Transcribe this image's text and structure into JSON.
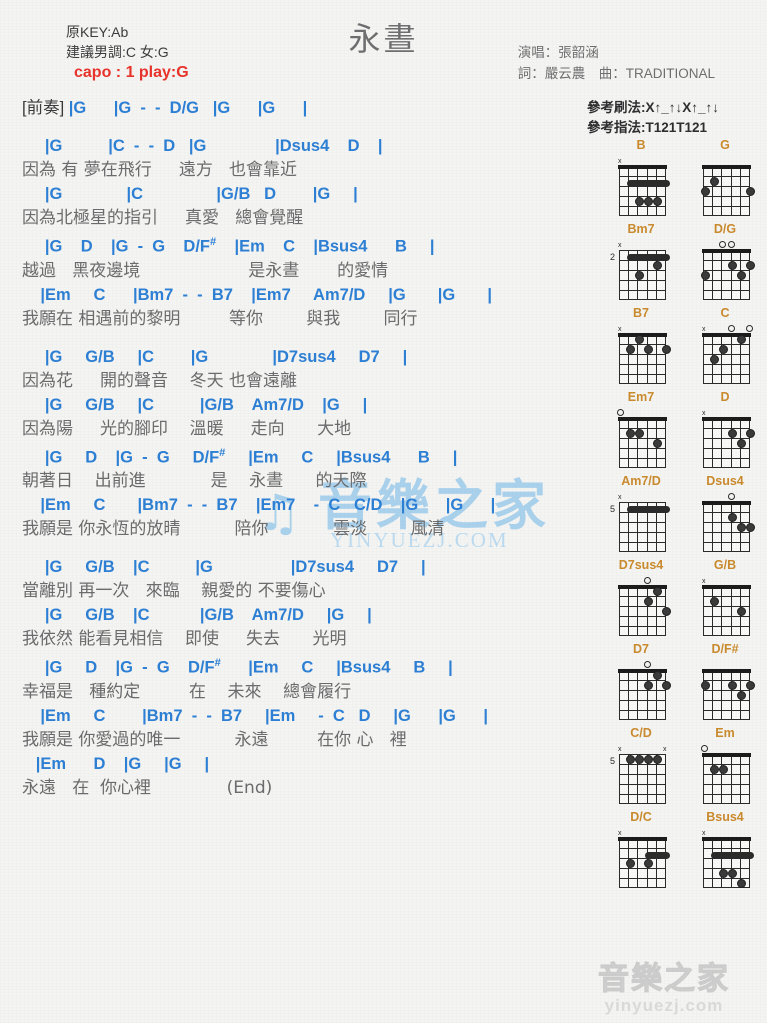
{
  "header": {
    "title": "永晝",
    "orig_key": "原KEY:Ab",
    "suggested_key": "建議男調:C 女:G",
    "capo": "capo : 1 play:G",
    "singer": "演唱：張韶涵",
    "credits": "詞：嚴云農　曲：TRADITIONAL",
    "strum_pattern": "參考刷法:X↑_↑↓X↑_↑↓",
    "picking_pattern": "參考指法:T121T121"
  },
  "song": {
    "sections": [
      {
        "label": "[前奏]",
        "lines": [
          {
            "type": "chord_with_label",
            "label": "[前奏]",
            "chords": "|G      |G  -  -  D/G   |G      |G      |"
          }
        ]
      },
      {
        "lines": [
          {
            "type": "chord",
            "text": "     |G          |C  -  -  D   |G               |Dsus4    D    |"
          },
          {
            "type": "lyric",
            "text": "因為 有 夢在飛行     遠方   也會靠近"
          },
          {
            "type": "chord",
            "text": "     |G              |C                |G/B   D        |G     |"
          },
          {
            "type": "lyric",
            "text": "因為北極星的指引     真愛   總會覺醒"
          },
          {
            "type": "chord",
            "text": "     |G    D    |G  -  G    D/F#    |Em    C    |Bsus4      B     |"
          },
          {
            "type": "lyric",
            "text": "越過   黑夜邊境                    是永晝       的愛情"
          },
          {
            "type": "chord",
            "text": "    |Em     C      |Bm7  -  -  B7    |Em7     Am7/D     |G       |G       |"
          },
          {
            "type": "lyric",
            "text": "我願在 相遇前的黎明         等你        與我        同行"
          }
        ]
      },
      {
        "lines": [
          {
            "type": "chord",
            "text": "     |G     G/B     |C        |G              |D7sus4     D7     |"
          },
          {
            "type": "lyric",
            "text": "因為花     開的聲音    冬天 也會遠離"
          },
          {
            "type": "chord",
            "text": "     |G     G/B     |C          |G/B    Am7/D    |G     |"
          },
          {
            "type": "lyric",
            "text": "因為陽     光的腳印    溫暖     走向      大地"
          },
          {
            "type": "chord",
            "text": "     |G     D    |G  -  G     D/F#     |Em     C     |Bsus4      B     |"
          },
          {
            "type": "lyric",
            "text": "朝著日    出前進            是    永晝      的天際"
          },
          {
            "type": "chord",
            "text": "    |Em     C       |Bm7  -  -  B7    |Em7    -  C   C/D    |G      |G      |"
          },
          {
            "type": "lyric",
            "text": "我願是 你永恆的放晴          陪你            雲淡        風清"
          }
        ]
      },
      {
        "lines": [
          {
            "type": "chord",
            "text": "     |G     G/B    |C          |G                 |D7sus4     D7     |"
          },
          {
            "type": "lyric",
            "text": "當離別 再一次   來臨    親愛的 不要傷心"
          },
          {
            "type": "chord",
            "text": "     |G     G/B    |C           |G/B    Am7/D     |G     |"
          },
          {
            "type": "lyric",
            "text": "我依然 能看見相信    即使     失去      光明"
          },
          {
            "type": "chord",
            "text": "     |G     D    |G  -  G    D/F#      |Em     C     |Bsus4     B     |"
          },
          {
            "type": "lyric",
            "text": "幸福是   種約定         在    未來    總會履行"
          },
          {
            "type": "chord",
            "text": "    |Em     C        |Bm7  -  -  B7     |Em     -  C   D     |G      |G      |"
          },
          {
            "type": "lyric",
            "text": "我願是 你愛過的唯一          永遠         在你 心   裡"
          },
          {
            "type": "chord",
            "text": "   |Em      D    |G     |G     |"
          },
          {
            "type": "lyric",
            "text": "永遠   在  你心裡              (End)"
          }
        ]
      }
    ]
  },
  "chord_diagrams": [
    {
      "name": "B",
      "startFret": "",
      "markers": "x-----",
      "dots": [
        [
          4,
          2
        ],
        [
          4,
          3
        ],
        [
          4,
          4
        ]
      ],
      "barre": {
        "fret": 2,
        "from": 5,
        "to": 1
      }
    },
    {
      "name": "G",
      "startFret": "",
      "markers": "------",
      "dots": [
        [
          3,
          6
        ],
        [
          2,
          5
        ],
        [
          3,
          1
        ]
      ],
      "barre": null
    },
    {
      "name": "Bm7",
      "startFret": "2",
      "markers": "x-----",
      "dots": [
        [
          3,
          4
        ],
        [
          2,
          2
        ]
      ],
      "barre": {
        "fret": 1,
        "from": 5,
        "to": 1
      }
    },
    {
      "name": "D/G",
      "startFret": "",
      "markers": "--oo--",
      "dots": [
        [
          3,
          6
        ],
        [
          2,
          3
        ],
        [
          3,
          2
        ],
        [
          2,
          1
        ]
      ],
      "barre": null
    },
    {
      "name": "B7",
      "startFret": "",
      "markers": "x-----",
      "dots": [
        [
          1,
          4
        ],
        [
          2,
          5
        ],
        [
          2,
          3
        ],
        [
          2,
          1
        ]
      ],
      "barre": null
    },
    {
      "name": "C",
      "startFret": "",
      "markers": "x--o-o",
      "dots": [
        [
          3,
          5
        ],
        [
          2,
          4
        ],
        [
          1,
          2
        ]
      ],
      "barre": null
    },
    {
      "name": "Em7",
      "startFret": "",
      "markers": "o-----",
      "dots": [
        [
          2,
          5
        ],
        [
          2,
          4
        ],
        [
          3,
          2
        ]
      ],
      "barre": null
    },
    {
      "name": "D",
      "startFret": "",
      "markers": "x-----",
      "dots": [
        [
          2,
          3
        ],
        [
          3,
          2
        ],
        [
          2,
          1
        ]
      ],
      "barre": null
    },
    {
      "name": "Am7/D",
      "startFret": "5",
      "markers": "x-----",
      "dots": [],
      "barre": {
        "fret": 1,
        "from": 5,
        "to": 1
      }
    },
    {
      "name": "Dsus4",
      "startFret": "",
      "markers": "---o--",
      "dots": [
        [
          2,
          3
        ],
        [
          3,
          2
        ],
        [
          3,
          1
        ]
      ],
      "barre": null
    },
    {
      "name": "D7sus4",
      "startFret": "",
      "markers": "---o--",
      "dots": [
        [
          1,
          2
        ],
        [
          2,
          3
        ],
        [
          3,
          1
        ]
      ],
      "barre": null
    },
    {
      "name": "G/B",
      "startFret": "",
      "markers": "x-----",
      "dots": [
        [
          2,
          5
        ],
        [
          3,
          2
        ]
      ],
      "barre": null
    },
    {
      "name": "D7",
      "startFret": "",
      "markers": "---o--",
      "dots": [
        [
          1,
          2
        ],
        [
          2,
          3
        ],
        [
          2,
          1
        ]
      ],
      "barre": null
    },
    {
      "name": "D/F#",
      "startFret": "",
      "markers": "------",
      "dots": [
        [
          2,
          6
        ],
        [
          2,
          3
        ],
        [
          3,
          2
        ],
        [
          2,
          1
        ]
      ],
      "barre": null
    },
    {
      "name": "C/D",
      "startFret": "5",
      "markers": "x----x",
      "dots": [
        [
          1,
          5
        ],
        [
          1,
          4
        ],
        [
          1,
          3
        ],
        [
          1,
          2
        ]
      ],
      "barre": null
    },
    {
      "name": "Em",
      "startFret": "",
      "markers": "o-----",
      "dots": [
        [
          2,
          5
        ],
        [
          2,
          4
        ]
      ],
      "barre": null
    },
    {
      "name": "D/C",
      "startFret": "",
      "markers": "x-----",
      "dots": [
        [
          3,
          5
        ],
        [
          3,
          3
        ]
      ],
      "barre": {
        "fret": 2,
        "from": 3,
        "to": 1
      }
    },
    {
      "name": "Bsus4",
      "startFret": "",
      "markers": "x-----",
      "dots": [
        [
          4,
          4
        ],
        [
          4,
          3
        ],
        [
          5,
          2
        ]
      ],
      "barre": {
        "fret": 2,
        "from": 5,
        "to": 1
      }
    }
  ],
  "watermarks": {
    "center_text": "音樂之家",
    "center_sub": "YINYUEZJ.COM",
    "bottom_text": "音樂之家",
    "bottom_sub": "yinyuezj.com"
  }
}
